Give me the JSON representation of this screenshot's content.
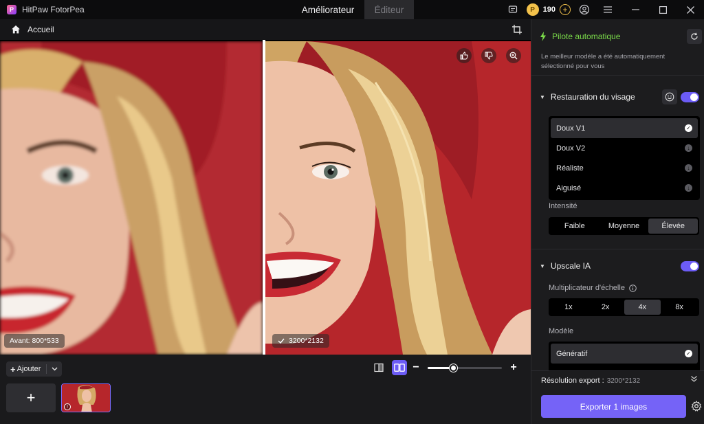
{
  "app": {
    "name": "HitPaw FotorPea",
    "logo_letter": "P"
  },
  "tabs": [
    {
      "label": "Améliorateur",
      "active": true
    },
    {
      "label": "Éditeur",
      "active": false
    }
  ],
  "titlebar": {
    "credits": "190"
  },
  "breadcrumb": {
    "label": "Accueil"
  },
  "viewer": {
    "before_label": "Avant: 800*533",
    "after_label": "3200*2132"
  },
  "bottom": {
    "add_label": "Ajouter",
    "zoom_level": 0.35
  },
  "panel": {
    "autopilot": {
      "title": "Pilote automatique",
      "description": "Le meilleur modèle a été automatiquement sélectionné pour vous"
    },
    "face": {
      "title": "Restauration du visage",
      "enabled": true,
      "models": [
        {
          "label": "Doux V1",
          "selected": true
        },
        {
          "label": "Doux V2",
          "selected": false
        },
        {
          "label": "Réaliste",
          "selected": false
        },
        {
          "label": "Aiguisé",
          "selected": false
        }
      ],
      "intensity_label": "Intensité",
      "intensity_options": [
        {
          "label": "Faible",
          "active": false
        },
        {
          "label": "Moyenne",
          "active": false
        },
        {
          "label": "Élevée",
          "active": true
        }
      ]
    },
    "upscale": {
      "title": "Upscale IA",
      "enabled": true,
      "scale_label": "Multiplicateur d'échelle",
      "scale_options": [
        {
          "label": "1x",
          "active": false
        },
        {
          "label": "2x",
          "active": false
        },
        {
          "label": "4x",
          "active": true
        },
        {
          "label": "8x",
          "active": false
        }
      ],
      "model_label": "Modèle",
      "models": [
        {
          "label": "Génératif",
          "selected": true
        }
      ]
    },
    "export": {
      "resolution_label": "Résolution export :",
      "resolution_value": "3200*2132",
      "button_label": "Exporter 1 images"
    }
  },
  "colors": {
    "accent": "#6c5cf5",
    "autopilot_green": "#7bdc4a",
    "photo_background": "#b6262b"
  }
}
